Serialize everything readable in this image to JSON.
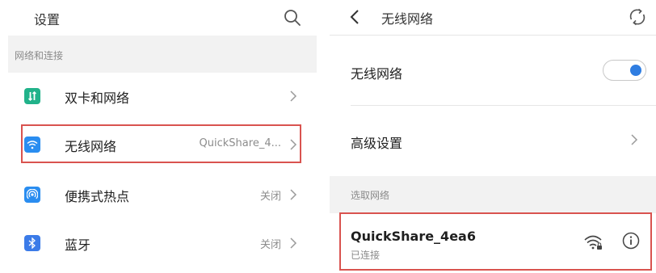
{
  "settings_panel": {
    "title": "设置",
    "section_label": "网络和连接",
    "items": [
      {
        "label": "双卡和网络",
        "value": "",
        "icon": "dual-sim-icon",
        "color": "#21b28a"
      },
      {
        "label": "无线网络",
        "value": "QuickShare_4...",
        "icon": "wifi-icon",
        "color": "#2a8df0"
      },
      {
        "label": "便携式热点",
        "value": "关闭",
        "icon": "hotspot-icon",
        "color": "#2a8df0"
      },
      {
        "label": "蓝牙",
        "value": "关闭",
        "icon": "bluetooth-icon",
        "color": "#3b7be8"
      }
    ]
  },
  "wifi_panel": {
    "title": "无线网络",
    "wifi_toggle_label": "无线网络",
    "wifi_enabled": true,
    "advanced_label": "高级设置",
    "section_label": "选取网络",
    "network": {
      "ssid": "QuickShare_4ea6",
      "status": "已连接"
    }
  },
  "colors": {
    "highlight": "#d9534f",
    "accent": "#2f7de1",
    "section_bg": "#f2f2f2"
  }
}
